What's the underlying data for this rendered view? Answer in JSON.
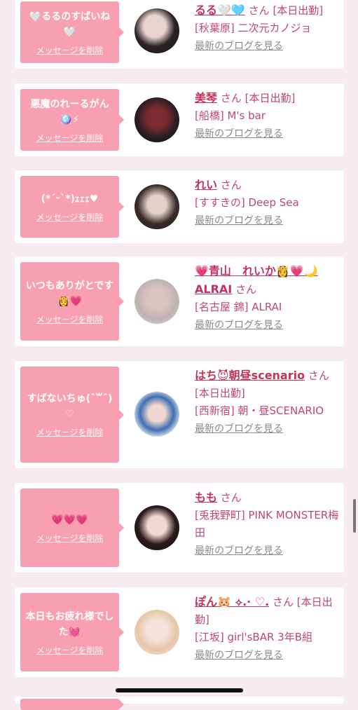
{
  "delete_label": "メッセージを削除",
  "blog_label": "最新のブログを見る",
  "san": "さん",
  "items": [
    {
      "message": "🤍るるのすばいね🤍",
      "name": "るる🤍🩵",
      "status": "[本日出勤]",
      "shop": "[秋葉原] 二次元カノジョ"
    },
    {
      "message": "悪魔のれーるがん🪩⚡",
      "name": "美琴",
      "status": "[本日出勤]",
      "shop": "[船橋] M's bar"
    },
    {
      "message": "(*ˊᵕˋ*)ｪｪｪ♥",
      "name": "れい",
      "status": "",
      "shop": "[すすきの] Deep Sea"
    },
    {
      "message": "いつもありがとです👸💗",
      "name": "💗青山　れいか👸💗🌙ALRAI",
      "status": "",
      "shop": "[名古屋 錦] ALRAI"
    },
    {
      "message": "すばないちゅ(ˆ꒳ˆ)♡",
      "name": "はち😈朝昼scenario",
      "status": "[本日出勤]",
      "shop": "[西新宿] 朝・昼SCENARIO"
    },
    {
      "message": "💗💗💗",
      "name": "もも",
      "status": "",
      "shop": "[兎我野町] PINK MONSTER梅田"
    },
    {
      "message": "本日もお疲れ様でした💓",
      "name": "ぽん🐹 ⟡.· ♡.",
      "status": "[本日出勤]",
      "shop": "[江坂] girl'sBAR 3年B組"
    }
  ]
}
